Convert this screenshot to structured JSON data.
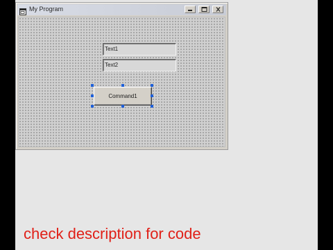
{
  "form": {
    "title": "My Program",
    "icon": "form-icon",
    "controls": {
      "minimize_icon": "minimize-icon",
      "maximize_icon": "maximize-icon",
      "close_icon": "close-icon"
    }
  },
  "controls": {
    "text1": "Text1",
    "text2": "Text2",
    "command1": "Command1"
  },
  "caption": "check description for code",
  "colors": {
    "caption": "#e02018",
    "selection_handle": "#1e5fd8",
    "background": "#e6e6e6"
  }
}
